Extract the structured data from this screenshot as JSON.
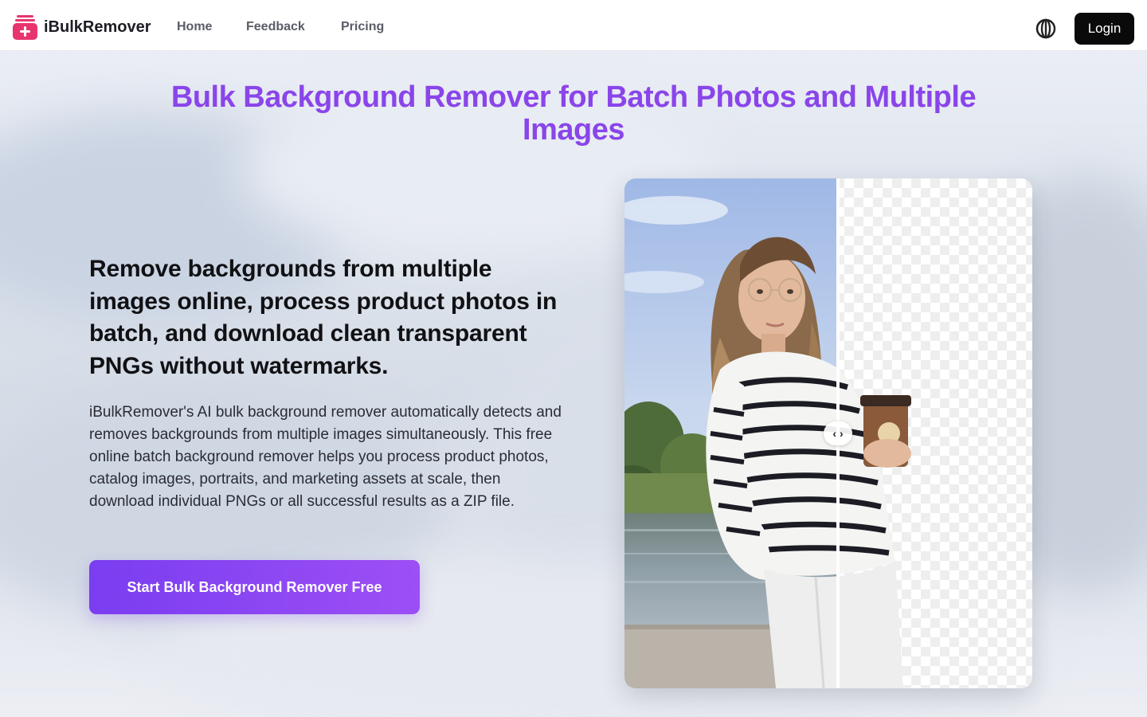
{
  "brand": {
    "name": "iBulkRemover"
  },
  "nav": {
    "links": [
      {
        "label": "Home"
      },
      {
        "label": "Feedback"
      },
      {
        "label": "Pricing"
      }
    ],
    "login_label": "Login",
    "theme_icon": "contrast-icon"
  },
  "hero": {
    "title": "Bulk Background Remover for Batch Photos and Multiple Images",
    "subhead": "Remove backgrounds from multiple images online, process product photos in batch, and download clean transparent PNGs without watermarks.",
    "description": "iBulkRemover's AI bulk background remover automatically detects and removes backgrounds from multiple images simultaneously. This free online batch background remover helps you process product photos, catalog images, portraits, and marketing assets at scale, then download individual PNGs or all successful results as a ZIP file.",
    "cta_label": "Start Bulk Background Remover Free"
  },
  "compare": {
    "handle_icon": "compare-arrows-icon",
    "handle_glyph": "‹ ›"
  },
  "colors": {
    "accent": "#8a45ea",
    "cta_start": "#7a3df0",
    "cta_end": "#9d4ff5",
    "logo": "#e8356f"
  }
}
